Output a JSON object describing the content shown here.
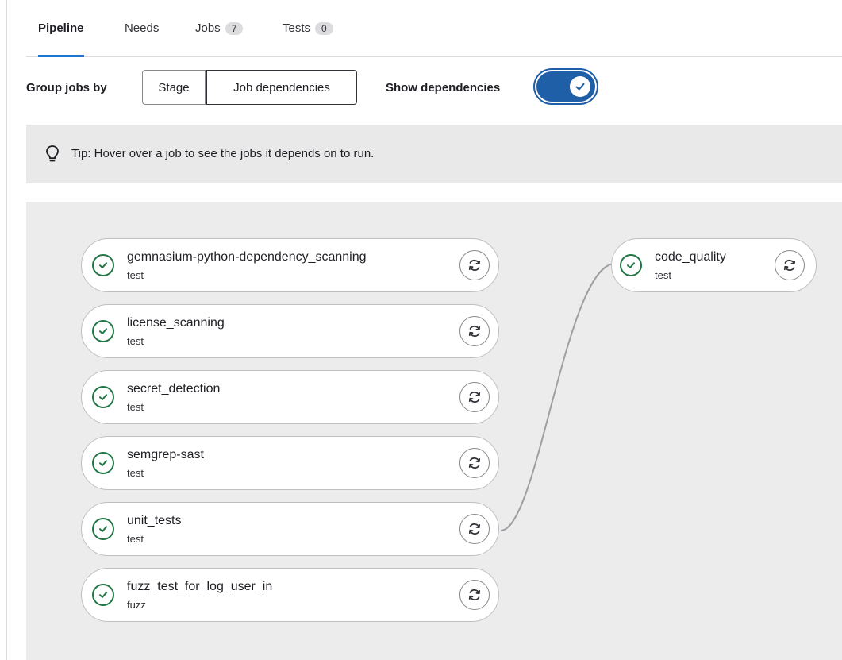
{
  "tabs": [
    {
      "label": "Pipeline",
      "active": true
    },
    {
      "label": "Needs"
    },
    {
      "label": "Jobs",
      "count": "7"
    },
    {
      "label": "Tests",
      "count": "0"
    }
  ],
  "toolbar": {
    "group_label": "Group jobs by",
    "stage_button": "Stage",
    "job_deps_button": "Job dependencies",
    "show_dependencies_label": "Show dependencies",
    "show_dependencies_on": true
  },
  "tip": {
    "icon": "lightbulb-icon",
    "text": "Tip: Hover over a job to see the jobs it depends on to run."
  },
  "jobs": [
    {
      "name": "gemnasium-python-dependency_scanning",
      "stage": "test",
      "status": "success"
    },
    {
      "name": "license_scanning",
      "stage": "test",
      "status": "success"
    },
    {
      "name": "secret_detection",
      "stage": "test",
      "status": "success"
    },
    {
      "name": "semgrep-sast",
      "stage": "test",
      "status": "success"
    },
    {
      "name": "unit_tests",
      "stage": "test",
      "status": "success"
    },
    {
      "name": "fuzz_test_for_log_user_in",
      "stage": "fuzz",
      "status": "success"
    },
    {
      "name": "code_quality",
      "stage": "test",
      "status": "success"
    }
  ],
  "dependencies": [
    {
      "from": "unit_tests",
      "to": "code_quality"
    }
  ],
  "colors": {
    "success": "#217645",
    "accent": "#1f75cb",
    "toggle": "#1f5fa8"
  }
}
